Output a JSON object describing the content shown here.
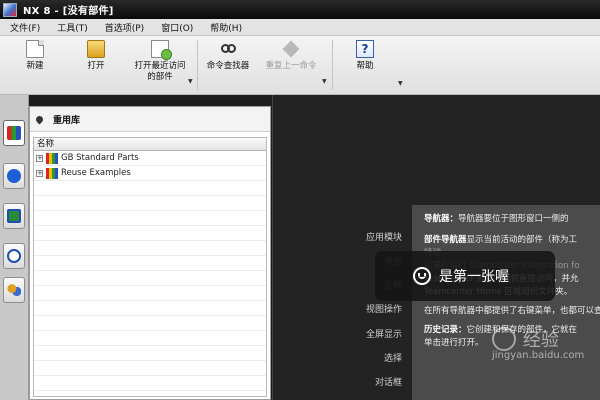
{
  "window": {
    "title": "NX 8 - [没有部件]"
  },
  "menubar": [
    "文件(F)",
    "工具(T)",
    "首选项(P)",
    "窗口(O)",
    "帮助(H)"
  ],
  "ribbon": {
    "new_label": "新建",
    "open_label": "打开",
    "recent_label_1": "打开最近访问",
    "recent_label_2": "的部件",
    "command_finder_label": "命令查找器",
    "repeat_label": "重复上一命令",
    "help_label": "帮助"
  },
  "library": {
    "title": "重用库",
    "column_header": "名称",
    "items": [
      "GB Standard Parts",
      "Reuse Examples"
    ]
  },
  "main_menu": [
    "应用模块",
    "角色",
    "定制",
    "视图操作",
    "全屏显示",
    "选择",
    "对话框"
  ],
  "info": {
    "nav_label": "导航器：",
    "nav_text": "导航器要位于图形窗口一侧的",
    "part_nav_label": "部件导航器",
    "part_nav_text": "显示当前活动的部件（称为工",
    "line3": "特动...",
    "line4": "如果在运行 Teamcenter Integration fo",
    "line5": "Teamcenter 数据库提供直接访问，并允",
    "line6": "Teamcenter Home 区域组织文件夹。",
    "line7": "在所有导航器中都提供了右键菜单，也都可以查",
    "history_label": "历史记录：",
    "history_text": "它创建和保存的部件，它就在",
    "line9": "单击进行打开。"
  },
  "toast": {
    "text": "是第一张喔"
  },
  "watermark": {
    "brand": "经验",
    "url": "jingyan.baidu.com"
  }
}
